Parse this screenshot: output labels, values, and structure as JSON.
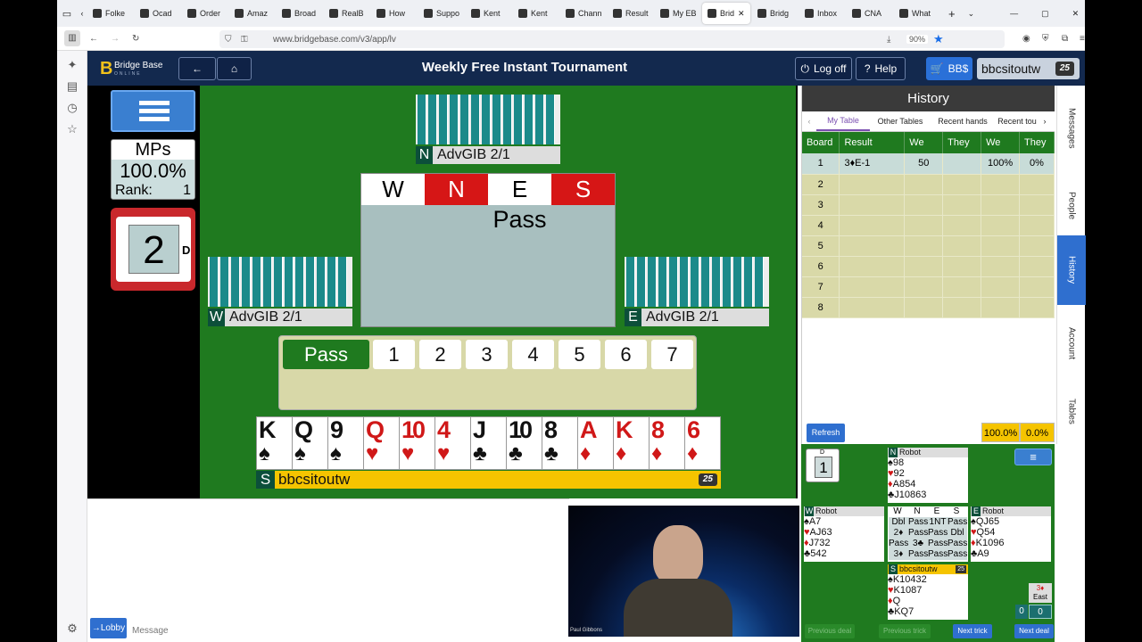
{
  "browser": {
    "tabs": [
      "Folke",
      "Ocad",
      "Order",
      "Amaz",
      "Broad",
      "RealB",
      "How",
      "Suppo",
      "Kent",
      "Kent",
      "Chann",
      "Result",
      "My EB",
      "Brid",
      "Bridg",
      "Inbox",
      "CNA",
      "What"
    ],
    "url": "www.bridgebase.com/v3/app/lv",
    "zoom": "90%"
  },
  "header": {
    "title": "Weekly Free Instant Tournament",
    "brand": "Bridge Base",
    "brand_sub": "ONLINE",
    "logout": "Log off",
    "help": "Help",
    "bbs": "BB$",
    "user": "bbcsitoutw",
    "badge": "25"
  },
  "score": {
    "label": "MPs",
    "pct": "100.0%",
    "rank_label": "Rank:",
    "rank": "1"
  },
  "board": {
    "number": "2",
    "dealer": "D"
  },
  "seats": {
    "north": {
      "dir": "N",
      "name": "AdvGIB 2/1"
    },
    "west": {
      "dir": "W",
      "name": "AdvGIB 2/1"
    },
    "east": {
      "dir": "E",
      "name": "AdvGIB 2/1"
    },
    "south": {
      "dir": "S",
      "name": "bbcsitoutw",
      "badge": "25"
    }
  },
  "auction": {
    "headers": [
      "W",
      "N",
      "E",
      "S"
    ],
    "calls": [
      "Pass"
    ]
  },
  "bidding": {
    "pass": "Pass",
    "levels": [
      "1",
      "2",
      "3",
      "4",
      "5",
      "6",
      "7"
    ]
  },
  "hand": [
    {
      "r": "K",
      "s": "♠",
      "c": "black"
    },
    {
      "r": "Q",
      "s": "♠",
      "c": "black"
    },
    {
      "r": "9",
      "s": "♠",
      "c": "black"
    },
    {
      "r": "Q",
      "s": "♥",
      "c": "red"
    },
    {
      "r": "10",
      "s": "♥",
      "c": "red"
    },
    {
      "r": "4",
      "s": "♥",
      "c": "red"
    },
    {
      "r": "J",
      "s": "♣",
      "c": "black"
    },
    {
      "r": "10",
      "s": "♣",
      "c": "black"
    },
    {
      "r": "8",
      "s": "♣",
      "c": "black"
    },
    {
      "r": "A",
      "s": "♦",
      "c": "red"
    },
    {
      "r": "K",
      "s": "♦",
      "c": "red"
    },
    {
      "r": "8",
      "s": "♦",
      "c": "red"
    },
    {
      "r": "6",
      "s": "♦",
      "c": "red"
    }
  ],
  "chat": {
    "lobby": "→Lobby",
    "placeholder": "Message",
    "video_caption": "Paul Gibbons"
  },
  "history": {
    "title": "History",
    "tabs": [
      "My Table",
      "Other Tables",
      "Recent hands",
      "Recent tou"
    ],
    "columns": [
      "Board",
      "Result",
      "We",
      "They",
      "We",
      "They"
    ],
    "rows": [
      [
        "1",
        "3♦E-1",
        "50",
        "",
        "100%",
        "0%"
      ],
      [
        "2",
        "",
        "",
        "",
        "",
        ""
      ],
      [
        "3",
        "",
        "",
        "",
        "",
        ""
      ],
      [
        "4",
        "",
        "",
        "",
        "",
        ""
      ],
      [
        "5",
        "",
        "",
        "",
        "",
        ""
      ],
      [
        "6",
        "",
        "",
        "",
        "",
        ""
      ],
      [
        "7",
        "",
        "",
        "",
        "",
        ""
      ],
      [
        "8",
        "",
        "",
        "",
        "",
        ""
      ]
    ],
    "refresh": "Refresh",
    "total_we": "100.0%",
    "total_they": "0.0%"
  },
  "side_tabs": [
    "Messages",
    "People",
    "History",
    "Account",
    "Tables"
  ],
  "mini": {
    "board": "1",
    "dealer": "D",
    "north": {
      "dir": "N",
      "name": "Robot",
      "s": "98",
      "h": "92",
      "d": "A854",
      "c": "J10863"
    },
    "west": {
      "dir": "W",
      "name": "Robot",
      "s": "A7",
      "h": "AJ63",
      "d": "J732",
      "c": "542"
    },
    "east": {
      "dir": "E",
      "name": "Robot",
      "s": "QJ65",
      "h": "Q54",
      "d": "K1096",
      "c": "A9"
    },
    "south": {
      "dir": "S",
      "name": "bbcsitoutw",
      "badge": "25",
      "s": "K10432",
      "h": "K1087",
      "d": "Q",
      "c": "KQ7"
    },
    "auction_head": [
      "W",
      "N",
      "E",
      "S"
    ],
    "auction": [
      [
        "Dbl",
        "Pass",
        "1NT",
        "Pass"
      ],
      [
        "2♦",
        "Pass",
        "Pass",
        "Dbl"
      ],
      [
        "Pass",
        "3♣",
        "Pass",
        "Pass"
      ],
      [
        "3♦",
        "Pass",
        "Pass",
        "Pass"
      ]
    ],
    "contract": "3♦",
    "declarer": "East",
    "tricks_ns": "0",
    "tricks_ew": "0",
    "buttons": [
      "Previous deal",
      "Previous trick",
      "Next trick",
      "Next deal"
    ]
  }
}
